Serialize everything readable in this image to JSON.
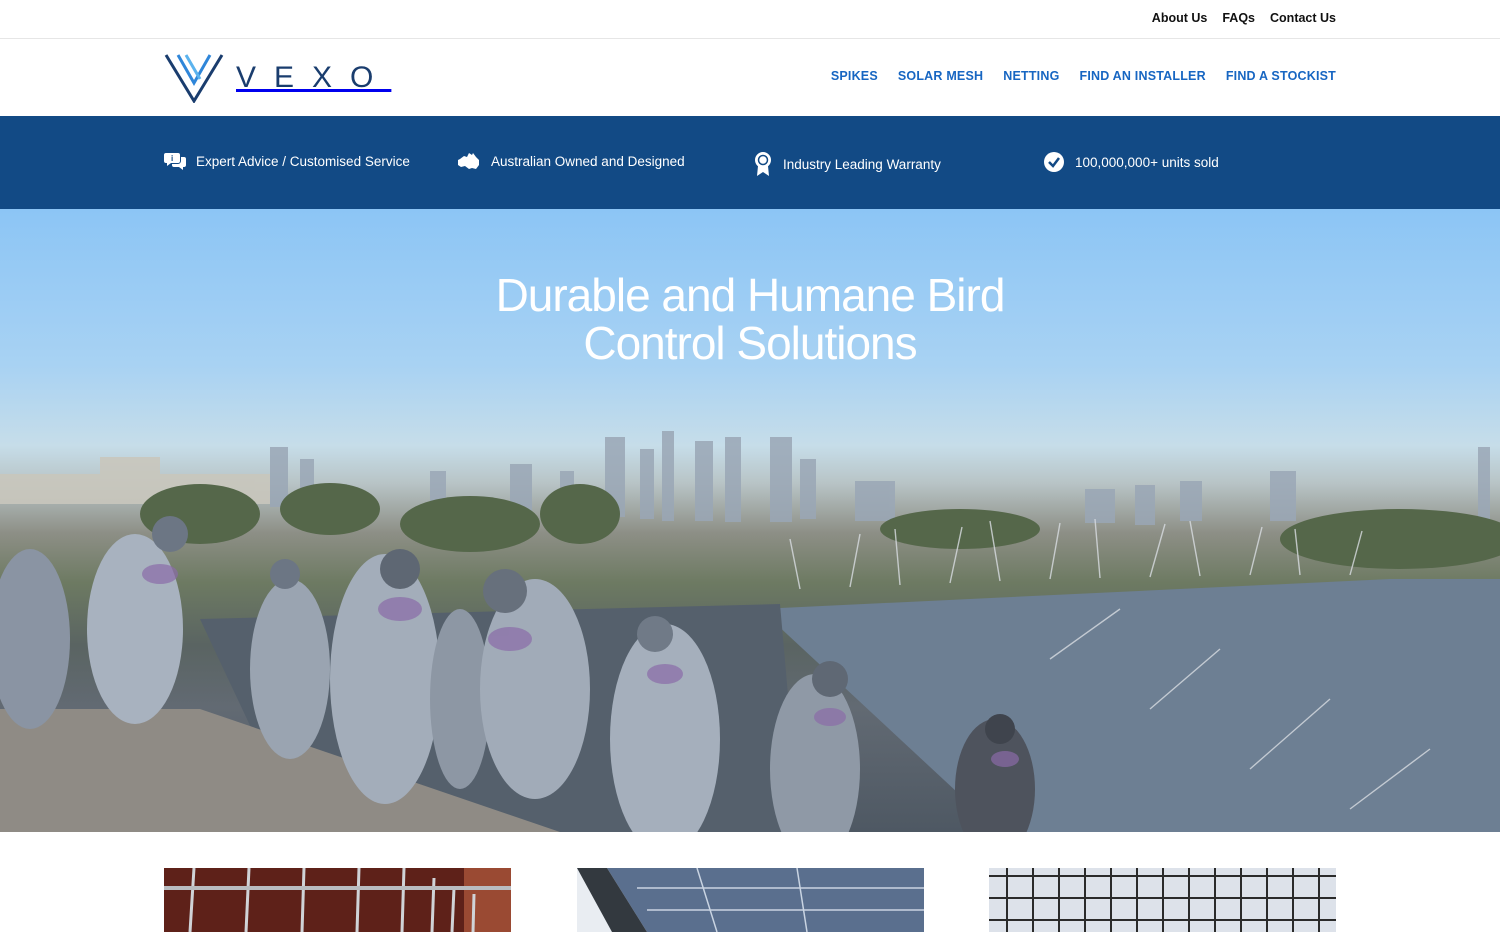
{
  "top_links": [
    "About Us",
    "FAQs",
    "Contact Us"
  ],
  "logo": {
    "text": "VEXO"
  },
  "nav": [
    "SPIKES",
    "SOLAR MESH",
    "NETTING",
    "FIND AN INSTALLER",
    "FIND A STOCKIST"
  ],
  "usp": [
    {
      "icon": "advice-chat-icon",
      "label": "Expert Advice / Customised Service"
    },
    {
      "icon": "australia-map-icon",
      "label": "Australian Owned and Designed"
    },
    {
      "icon": "award-ribbon-icon",
      "label": "Industry Leading Warranty"
    },
    {
      "icon": "check-circle-icon",
      "label": "100,000,000+ units sold"
    }
  ],
  "hero": {
    "title_line1": "Durable and Humane Bird",
    "title_line2": "Control Solutions"
  },
  "colors": {
    "brand_blue": "#124a85",
    "nav_blue": "#1766c2",
    "logo_navy": "#1a3d6e"
  }
}
